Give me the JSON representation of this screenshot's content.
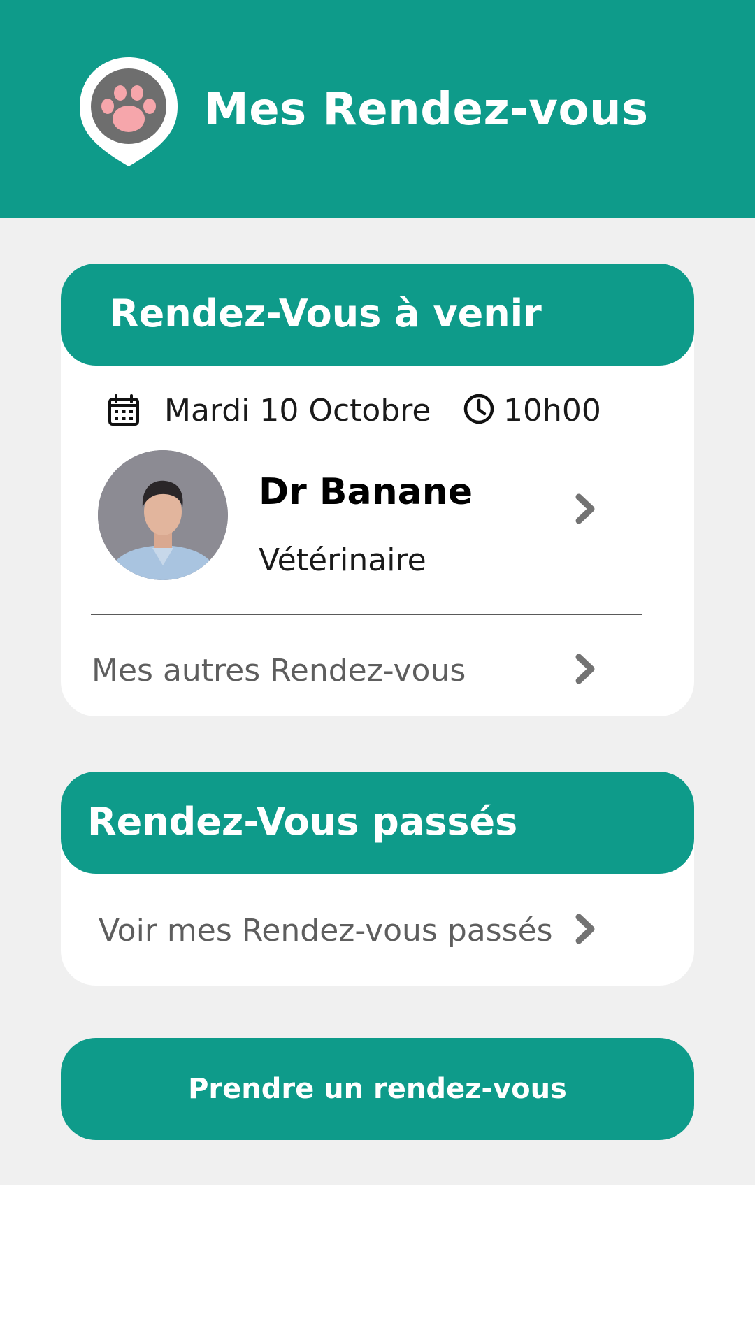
{
  "header": {
    "title": "Mes Rendez-vous",
    "logo_icon": "paw-pin-icon"
  },
  "upcoming": {
    "section_title": "Rendez-Vous à venir",
    "date": "Mardi 10 Octobre",
    "time": "10h00",
    "calendar_icon": "calendar-icon",
    "clock_icon": "clock-icon",
    "doctor": {
      "name": "Dr Banane",
      "role": "Vétérinaire"
    },
    "other_link_label": "Mes autres Rendez-vous"
  },
  "past": {
    "section_title": "Rendez-Vous passés",
    "link_label": "Voir mes Rendez-vous passés"
  },
  "actions": {
    "book_label": "Prendre un rendez-vous"
  },
  "colors": {
    "primary": "#0e9b8a",
    "background": "#f0f0f0",
    "chevron": "#737373"
  }
}
